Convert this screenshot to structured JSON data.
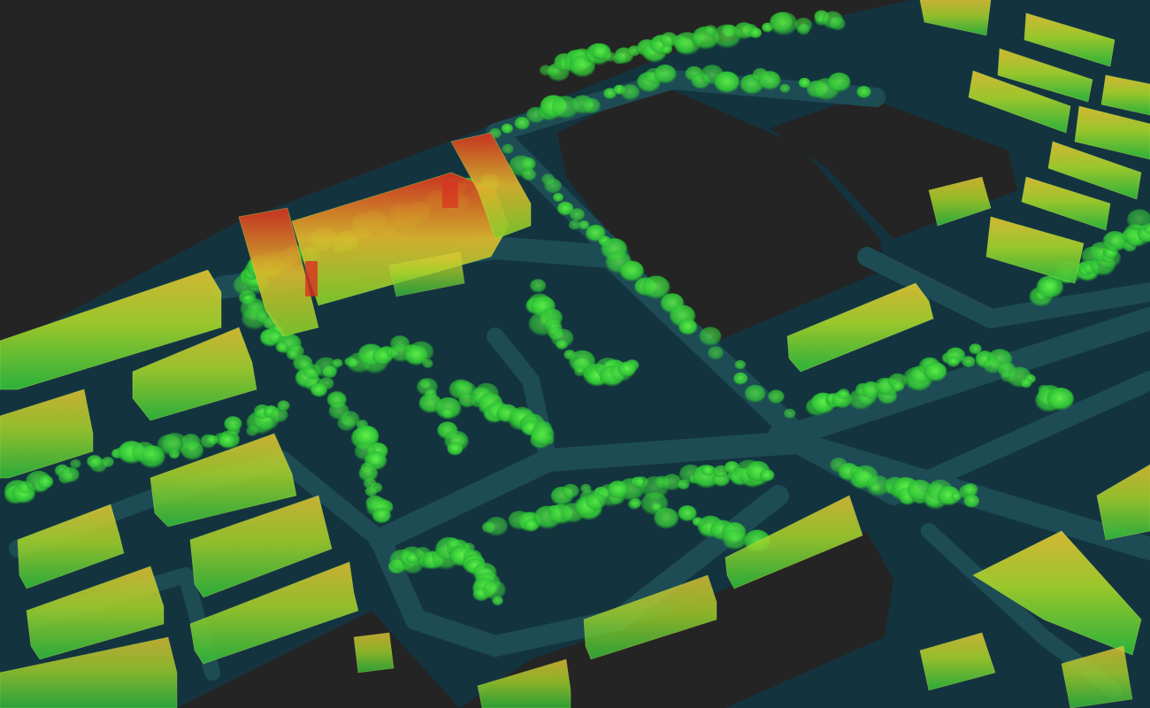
{
  "scene": {
    "kind": "lidar-point-cloud-city-block",
    "background_color": "#242424",
    "colormap": {
      "ground_low": "#0e2f3a",
      "ground": "#163f49",
      "road": "#1d4c55",
      "vegetation_dark": "#1c6b2a",
      "vegetation": "#2ec436",
      "vegetation_bright": "#62f24a",
      "building_base": "#2fbf3a",
      "building_mid": "#a8d62a",
      "building_high": "#e8c532",
      "building_peak": "#d8321f"
    }
  }
}
